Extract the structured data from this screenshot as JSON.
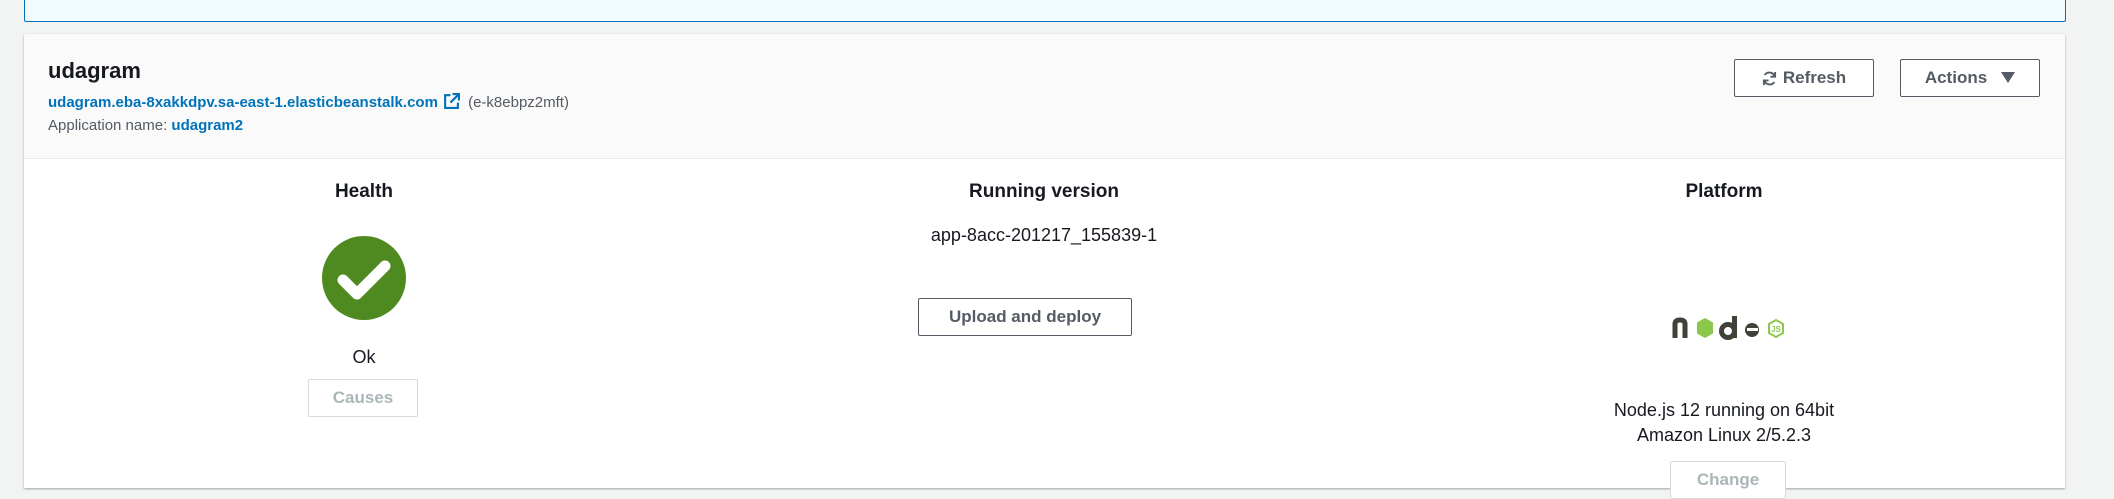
{
  "environment": {
    "name": "udagram",
    "url": "udagram.eba-8xakkdpv.sa-east-1.elasticbeanstalk.com",
    "id": "(e-k8ebpz2mft)",
    "app_name_label": "Application name:",
    "app_name": "udagram2"
  },
  "toolbar": {
    "refresh_label": "Refresh",
    "actions_label": "Actions"
  },
  "health": {
    "heading": "Health",
    "status": "Ok",
    "causes_label": "Causes"
  },
  "running_version": {
    "heading": "Running version",
    "version_label": "app-8acc-201217_155839-1",
    "upload_label": "Upload and deploy"
  },
  "platform": {
    "heading": "Platform",
    "description_line1": "Node.js 12 running on 64bit",
    "description_line2": "Amazon Linux 2/5.2.3",
    "change_label": "Change",
    "logo_text": "node JS"
  },
  "colors": {
    "link": "#0073bb",
    "health_ok": "#4f8a21",
    "node_green": "#8cc84b"
  }
}
